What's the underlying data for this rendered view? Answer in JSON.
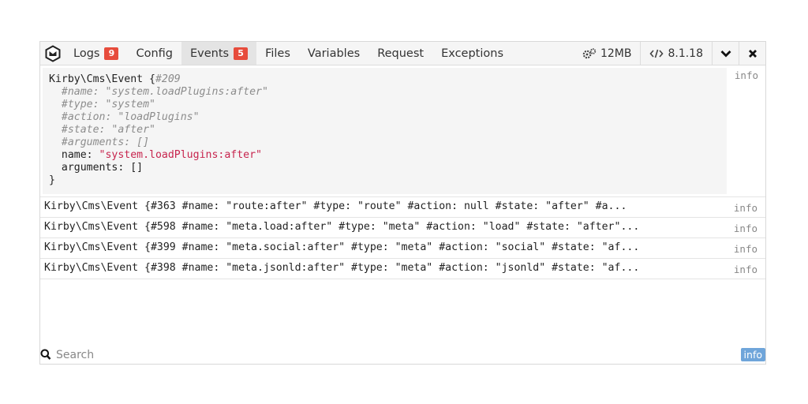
{
  "tabs": [
    {
      "label": "Logs",
      "badge": "9"
    },
    {
      "label": "Config"
    },
    {
      "label": "Events",
      "badge": "5"
    },
    {
      "label": "Files"
    },
    {
      "label": "Variables"
    },
    {
      "label": "Request"
    },
    {
      "label": "Exceptions"
    }
  ],
  "active_tab": "Events",
  "toolbar": {
    "memory": "12MB",
    "version": "8.1.18",
    "memory_icon": "gears-icon",
    "version_icon": "code-icon",
    "collapse_icon": "chevron-down-icon",
    "close_icon": "close-icon"
  },
  "events": {
    "expanded": {
      "line1": "Kirby\\Cms\\Event {",
      "id": "#209",
      "props": [
        "#name: \"system.loadPlugins:after\"",
        "#type: \"system\"",
        "#action: \"loadPlugins\"",
        "#state: \"after\"",
        "#arguments: []"
      ],
      "name_key": "name: ",
      "name_value": "\"system.loadPlugins:after\"",
      "arguments": "arguments: []",
      "close": "}",
      "level": "info"
    },
    "rows": [
      {
        "text": "Kirby\\Cms\\Event {#363 #name: \"route:after\" #type: \"route\" #action: null #state: \"after\" #a...",
        "level": "info"
      },
      {
        "text": "Kirby\\Cms\\Event {#598 #name: \"meta.load:after\" #type: \"meta\" #action: \"load\" #state: \"after\"...",
        "level": "info"
      },
      {
        "text": "Kirby\\Cms\\Event {#399 #name: \"meta.social:after\" #type: \"meta\" #action: \"social\" #state: \"af...",
        "level": "info"
      },
      {
        "text": "Kirby\\Cms\\Event {#398 #name: \"meta.jsonld:after\" #type: \"meta\" #action: \"jsonld\" #state: \"af...",
        "level": "info"
      }
    ]
  },
  "search": {
    "placeholder": "Search",
    "value": ""
  },
  "filter": {
    "level": "info"
  },
  "colors": {
    "badge": "#e74c3c",
    "string": "#c7254e",
    "info_pill": "#6fa5da"
  }
}
